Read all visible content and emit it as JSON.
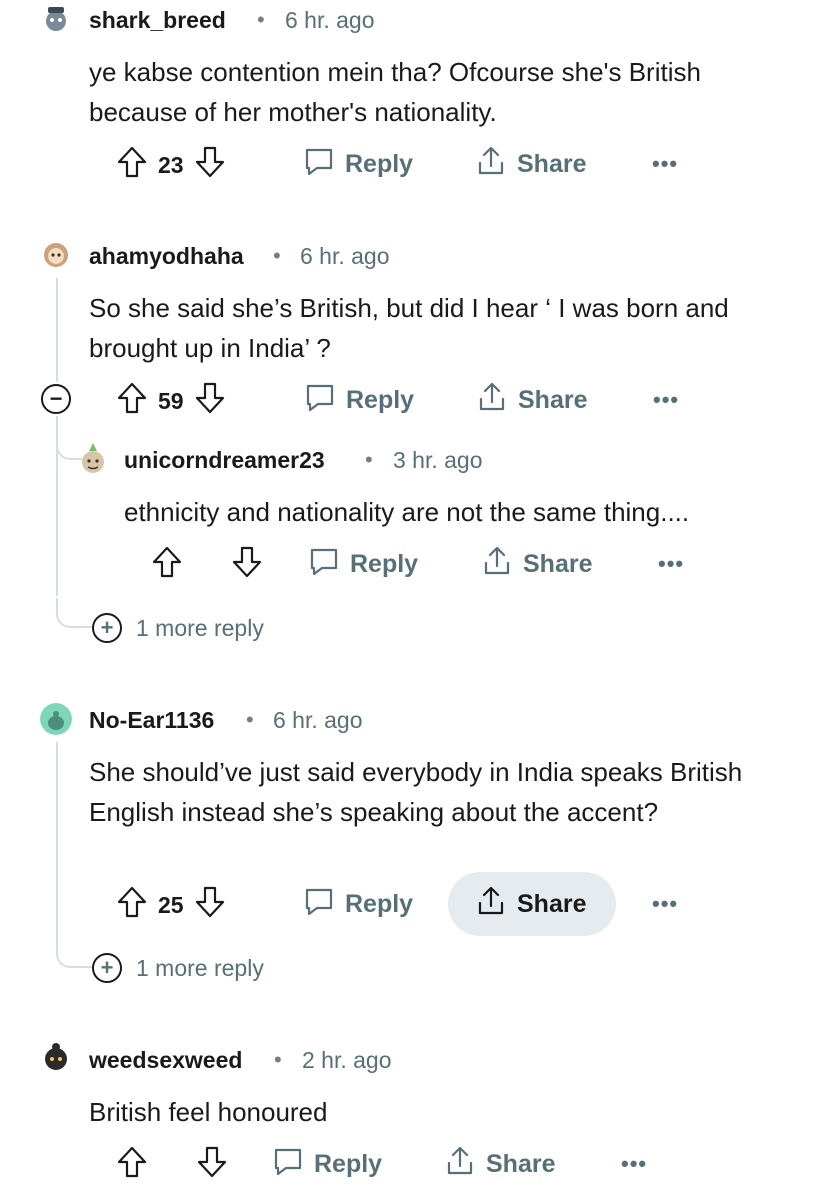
{
  "comments": [
    {
      "username": "shark_breed",
      "separator": "•",
      "time": "6 hr. ago",
      "text": "ye kabse contention mein tha? Ofcourse she's British because of her mother's nationality.",
      "score": "23",
      "reply_label": "Reply",
      "share_label": "Share",
      "more_label": "•••"
    },
    {
      "username": "ahamyodhaha",
      "separator": "•",
      "time": "6 hr. ago",
      "text": "So she said she’s British, but did I hear ‘ I was born and brought up in India’ ?",
      "score": "59",
      "reply_label": "Reply",
      "share_label": "Share",
      "more_label": "•••",
      "collapse_label": "−",
      "replies": [
        {
          "username": "unicorndreamer23",
          "separator": "•",
          "time": "3 hr. ago",
          "text": "ethnicity and nationality are not the same thing....",
          "reply_label": "Reply",
          "share_label": "Share",
          "more_label": "•••"
        }
      ],
      "more_replies_label": "1 more reply",
      "expand_label": "+"
    },
    {
      "username": "No-Ear1136",
      "separator": "•",
      "time": "6 hr. ago",
      "text": "She should’ve just said everybody in India speaks British English instead she’s speaking about the accent?",
      "score": "25",
      "reply_label": "Reply",
      "share_label": "Share",
      "more_label": "•••",
      "more_replies_label": "1 more reply",
      "expand_label": "+"
    },
    {
      "username": "weedsexweed",
      "separator": "•",
      "time": "2 hr. ago",
      "text": "British feel honoured",
      "reply_label": "Reply",
      "share_label": "Share",
      "more_label": "•••"
    }
  ],
  "colors": {
    "text": "#1a1a1b",
    "muted": "#576f76",
    "thread_line": "#d7dde0",
    "share_highlight": "#e5ebee"
  }
}
